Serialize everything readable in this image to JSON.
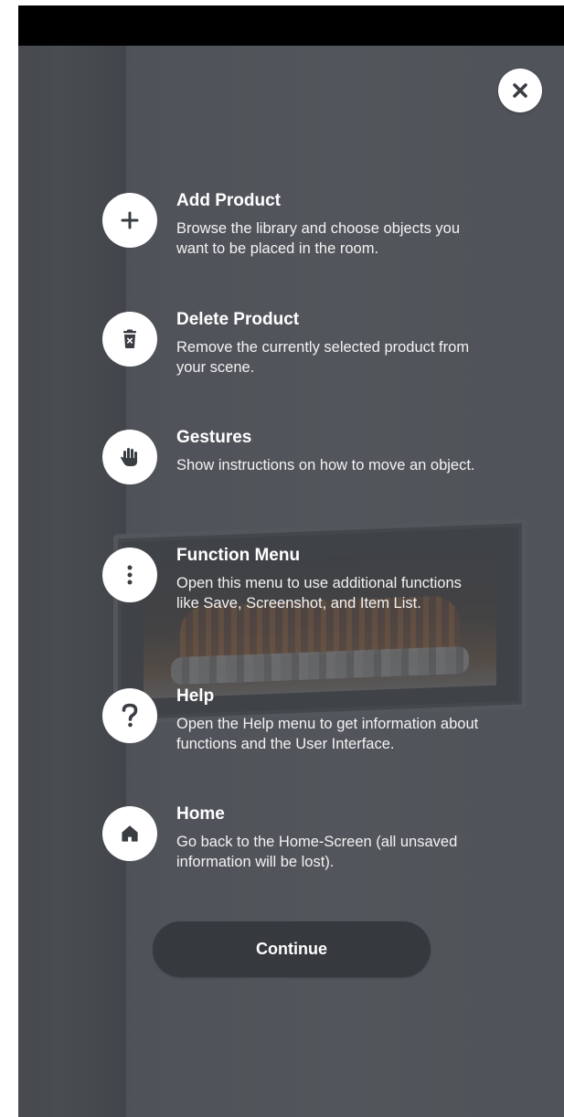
{
  "close_button": {
    "icon": "close-icon"
  },
  "items": [
    {
      "icon": "plus-icon",
      "title": "Add Product",
      "description": "Browse the library and choose objects you want to be placed in the room."
    },
    {
      "icon": "trash-icon",
      "title": "Delete Product",
      "description": "Remove the currently selected product from your scene."
    },
    {
      "icon": "hand-icon",
      "title": "Gestures",
      "description": "Show instructions on how to move an object."
    },
    {
      "icon": "more-vertical-icon",
      "title": "Function Menu",
      "description": "Open this menu to use additional functions like Save, Screenshot, and Item List."
    },
    {
      "icon": "question-icon",
      "title": "Help",
      "description": "Open the Help menu to get information about functions and the User Interface."
    },
    {
      "icon": "home-icon",
      "title": "Home",
      "description": "Go back to the Home-Screen (all unsaved information will be lost)."
    }
  ],
  "continue_label": "Continue",
  "colors": {
    "overlay": "#4c5056",
    "button_dark": "#36393e",
    "icon_fill": "#3a3d42",
    "text": "#ffffff"
  }
}
